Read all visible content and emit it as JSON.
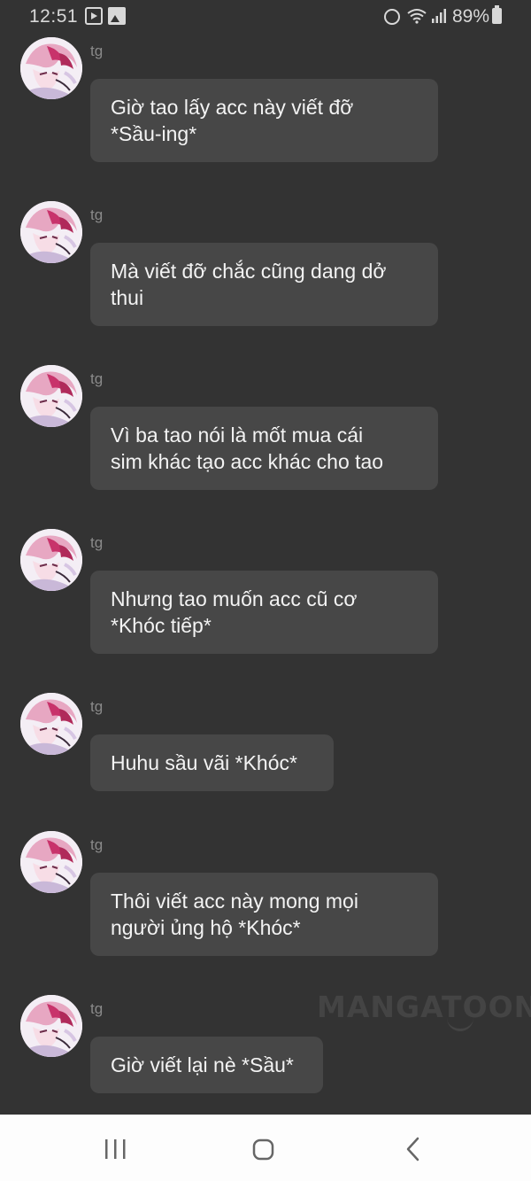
{
  "status_bar": {
    "time": "12:51",
    "battery": "89%",
    "icons": [
      "media-app-icon",
      "gallery-icon",
      "alarm-icon",
      "wifi-icon",
      "signal-icon",
      "battery-icon"
    ]
  },
  "messages": [
    {
      "sender": "tg",
      "text": "Giờ tao lấy acc này viết đỡ\n*Sầu-ing*"
    },
    {
      "sender": "tg",
      "text": "Mà viết đỡ chắc cũng dang dở\nthui"
    },
    {
      "sender": "tg",
      "text": "Vì ba tao nói là mốt mua cái\nsim khác tạo acc khác cho tao"
    },
    {
      "sender": "tg",
      "text": "Nhưng tao muốn acc cũ cơ\n*Khóc tiếp*"
    },
    {
      "sender": "tg",
      "text": "Huhu sầu vãi *Khóc*"
    },
    {
      "sender": "tg",
      "text": "Thôi viết acc này mong mọi\nngười ủng hộ *Khóc*"
    },
    {
      "sender": "tg",
      "text": "Giờ viết lại nè *Sầu*"
    }
  ],
  "watermark": "MANGATOON",
  "nav_bar": {
    "buttons": [
      "recents-icon",
      "home-icon",
      "back-icon"
    ]
  },
  "colors": {
    "background": "#333333",
    "bubble": "#474747",
    "sender_text": "#8a8a8a",
    "nav_background": "#fdfdfd"
  }
}
